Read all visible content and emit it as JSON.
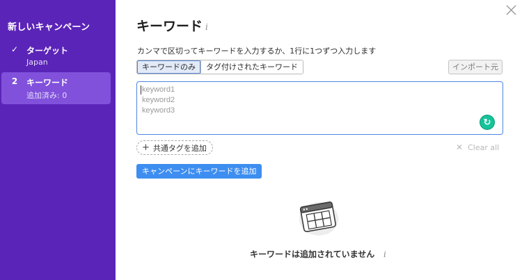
{
  "sidebar": {
    "title": "新しいキャンペーン",
    "steps": [
      {
        "marker": "✓",
        "label": "ターゲット",
        "sub": "Japan",
        "state": "completed"
      },
      {
        "marker": "2",
        "label": "キーワード",
        "sub": "追加済み: 0",
        "state": "active"
      }
    ],
    "colors": {
      "background": "#5b24b8",
      "active_step": "#8151dc"
    }
  },
  "close_icon": "close-icon",
  "main": {
    "title": "キーワード",
    "title_info_icon": "i",
    "instruction": "カンマで区切ってキーワードを入力するか、1行に1つずつ入力します",
    "tabs": [
      {
        "label": "キーワードのみ",
        "active": true
      },
      {
        "label": "タグ付けされたキーワード",
        "active": false
      }
    ],
    "import_button": "インポート元",
    "keywords_input": {
      "value": "",
      "placeholder_lines": [
        "keyword1",
        "keyword2",
        "keyword3"
      ]
    },
    "grammarly_icon": "G",
    "add_common_tag": {
      "plus": "+",
      "label": "共通タグを追加"
    },
    "clear_all": {
      "icon": "✕",
      "label": "Clear all"
    },
    "add_to_campaign_button": "キャンペーンにキーワードを追加",
    "empty_state": {
      "icon": "browser-window-table-icon",
      "text": "キーワードは追加されていません",
      "info_icon": "i"
    },
    "colors": {
      "accent": "#3d8ef0",
      "input_border": "#4a86e0",
      "grammarly": "#15c39a"
    }
  }
}
